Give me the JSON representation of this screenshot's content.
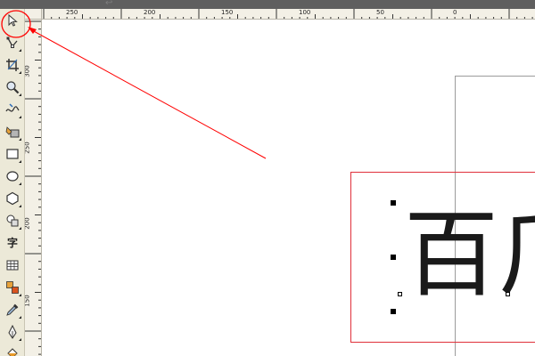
{
  "app": {
    "title_glyph": "↩"
  },
  "rulers": {
    "top": [
      "250",
      "200",
      "150",
      "100",
      "50",
      "0"
    ],
    "left": [
      "300",
      "250",
      "200",
      "150"
    ]
  },
  "toolbox": {
    "tools": [
      {
        "name": "pick-tool",
        "icon": "arrow-pointer-icon",
        "selected": true
      },
      {
        "name": "shape-tool",
        "icon": "shape-node-icon",
        "flyout": true
      },
      {
        "name": "crop-tool",
        "icon": "crop-icon",
        "flyout": true
      },
      {
        "name": "zoom-tool",
        "icon": "magnifier-icon",
        "flyout": true
      },
      {
        "name": "freehand-tool",
        "icon": "freehand-curve-icon",
        "flyout": true
      },
      {
        "name": "smart-fill-tool",
        "icon": "smart-fill-icon",
        "flyout": true
      },
      {
        "name": "rectangle-tool",
        "icon": "rectangle-icon",
        "flyout": true
      },
      {
        "name": "ellipse-tool",
        "icon": "ellipse-icon",
        "flyout": true
      },
      {
        "name": "polygon-tool",
        "icon": "polygon-icon",
        "flyout": true
      },
      {
        "name": "basic-shapes-tool",
        "icon": "basic-shapes-icon",
        "flyout": true
      },
      {
        "name": "text-tool",
        "icon": "text-icon",
        "label": "字"
      },
      {
        "name": "table-tool",
        "icon": "table-icon"
      },
      {
        "name": "interactive-tool",
        "icon": "interactive-blend-icon",
        "flyout": true
      },
      {
        "name": "eyedropper-tool",
        "icon": "eyedropper-icon",
        "flyout": true
      },
      {
        "name": "outline-tool",
        "icon": "pen-nib-icon",
        "flyout": true
      },
      {
        "name": "fill-tool",
        "icon": "fill-bucket-icon",
        "flyout": true
      }
    ]
  },
  "canvas": {
    "text_object": "百⺁",
    "selection_color": "#e0303a",
    "annotation_color": "#ff0000"
  }
}
